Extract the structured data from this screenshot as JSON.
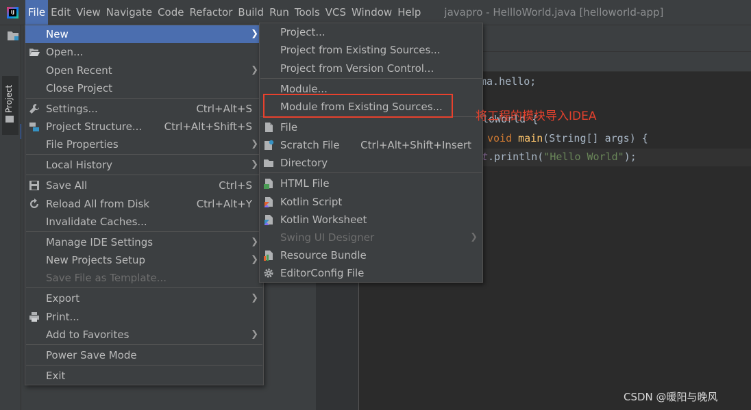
{
  "menubar": {
    "logo_text": "IJ",
    "items": [
      "File",
      "Edit",
      "View",
      "Navigate",
      "Code",
      "Refactor",
      "Build",
      "Run",
      "Tools",
      "VCS",
      "Window",
      "Help"
    ],
    "window_title": "javapro - HellloWorld.java [helloworld-app]"
  },
  "toolstrip": {
    "project_tab": "Project"
  },
  "editor": {
    "lines": {
      "l1": "ma.hello;",
      "l2": "loWorld {",
      "l3_kw": "void ",
      "l3_fn": "main",
      "l3_rest": "(String[] args) {",
      "l4_it": "t",
      "l4_rest": ".println(",
      "l4_str": "\"Hello World\"",
      "l4_end": ");"
    }
  },
  "file_menu": {
    "items": [
      {
        "label": "New",
        "shortcut": "",
        "submenu": true,
        "icon": "none"
      },
      {
        "label": "Open...",
        "shortcut": "",
        "submenu": false,
        "icon": "open-folder-icon"
      },
      {
        "label": "Open Recent",
        "shortcut": "",
        "submenu": true,
        "icon": "none"
      },
      {
        "label": "Close Project",
        "shortcut": "",
        "submenu": false,
        "icon": "none"
      },
      {
        "label": "Settings...",
        "shortcut": "Ctrl+Alt+S",
        "submenu": false,
        "icon": "wrench-icon"
      },
      {
        "label": "Project Structure...",
        "shortcut": "Ctrl+Alt+Shift+S",
        "submenu": false,
        "icon": "project-structure-icon"
      },
      {
        "label": "File Properties",
        "shortcut": "",
        "submenu": true,
        "icon": "none"
      },
      {
        "label": "Local History",
        "shortcut": "",
        "submenu": true,
        "icon": "none"
      },
      {
        "label": "Save All",
        "shortcut": "Ctrl+S",
        "submenu": false,
        "icon": "save-icon"
      },
      {
        "label": "Reload All from Disk",
        "shortcut": "Ctrl+Alt+Y",
        "submenu": false,
        "icon": "reload-icon"
      },
      {
        "label": "Invalidate Caches...",
        "shortcut": "",
        "submenu": false,
        "icon": "none"
      },
      {
        "label": "Manage IDE Settings",
        "shortcut": "",
        "submenu": true,
        "icon": "none"
      },
      {
        "label": "New Projects Setup",
        "shortcut": "",
        "submenu": true,
        "icon": "none"
      },
      {
        "label": "Save File as Template...",
        "shortcut": "",
        "submenu": false,
        "icon": "none",
        "disabled": true
      },
      {
        "label": "Export",
        "shortcut": "",
        "submenu": true,
        "icon": "none"
      },
      {
        "label": "Print...",
        "shortcut": "",
        "submenu": false,
        "icon": "print-icon"
      },
      {
        "label": "Add to Favorites",
        "shortcut": "",
        "submenu": true,
        "icon": "none"
      },
      {
        "label": "Power Save Mode",
        "shortcut": "",
        "submenu": false,
        "icon": "none"
      },
      {
        "label": "Exit",
        "shortcut": "",
        "submenu": false,
        "icon": "none"
      }
    ]
  },
  "new_menu": {
    "items": [
      {
        "label": "Project...",
        "shortcut": "",
        "icon": "none"
      },
      {
        "label": "Project from Existing Sources...",
        "shortcut": "",
        "icon": "none"
      },
      {
        "label": "Project from Version Control...",
        "shortcut": "",
        "icon": "none"
      },
      {
        "label": "Module...",
        "shortcut": "",
        "icon": "none"
      },
      {
        "label": "Module from Existing Sources...",
        "shortcut": "",
        "icon": "none"
      },
      {
        "label": "File",
        "shortcut": "",
        "icon": "file-icon"
      },
      {
        "label": "Scratch File",
        "shortcut": "Ctrl+Alt+Shift+Insert",
        "icon": "scratch-file-icon"
      },
      {
        "label": "Directory",
        "shortcut": "",
        "icon": "directory-icon"
      },
      {
        "label": "HTML File",
        "shortcut": "",
        "icon": "html-file-icon"
      },
      {
        "label": "Kotlin Script",
        "shortcut": "",
        "icon": "kotlin-icon"
      },
      {
        "label": "Kotlin Worksheet",
        "shortcut": "",
        "icon": "kotlin-icon"
      },
      {
        "label": "Swing UI Designer",
        "shortcut": "",
        "icon": "none",
        "disabled": true,
        "submenu": true
      },
      {
        "label": "Resource Bundle",
        "shortcut": "",
        "icon": "resource-bundle-icon"
      },
      {
        "label": "EditorConfig File",
        "shortcut": "",
        "icon": "gear-icon"
      }
    ]
  },
  "annotation": "将工程的模块导入IDEA",
  "watermark": "CSDN @暖阳与晚风",
  "colors": {
    "menu_bg": "#3c3f41",
    "highlight": "#4b6eaf",
    "annotation_red": "#e5412d",
    "editor_bg": "#2b2b2b"
  }
}
